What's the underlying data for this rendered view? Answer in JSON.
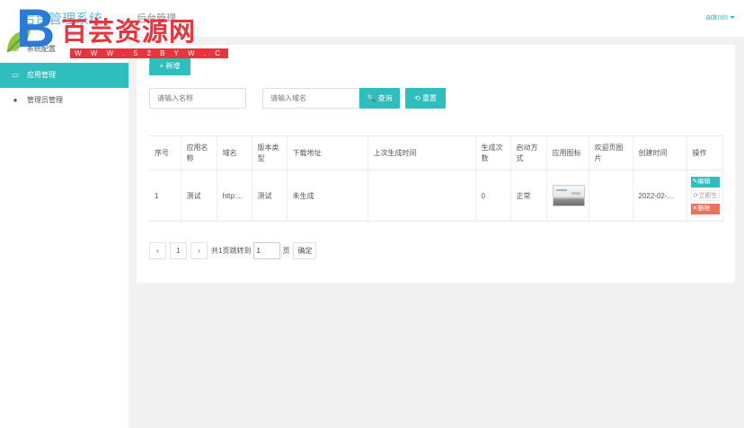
{
  "header": {
    "title": "后台管理系统",
    "subtitle": "后台管理",
    "user": "admin",
    "watermark_title": "百芸资源网",
    "watermark_url": "W W W . 5 2 B Y W . C N"
  },
  "sidebar": {
    "items": [
      {
        "label": "系统配置",
        "icon": "clipboard-icon",
        "active": false
      },
      {
        "label": "应用管理",
        "icon": "clipboard-icon",
        "active": true
      },
      {
        "label": "管理员管理",
        "icon": "user-icon",
        "active": false
      }
    ]
  },
  "toolbar": {
    "add_label": "+ 新增",
    "name_placeholder": "请输入名称",
    "domain_placeholder": "请输入域名",
    "search_label": "🔍 查询",
    "reset_label": "⟲ 重置"
  },
  "table": {
    "columns": [
      "序号",
      "应用名称",
      "域名",
      "版本类型",
      "下载地址",
      "上次生成时间",
      "生成次数",
      "启动方式",
      "应用图标",
      "欢迎页图片",
      "创建时间",
      "操作"
    ],
    "rows": [
      {
        "index": "1",
        "name": "测试",
        "domain": "http:...",
        "version_type": "测试",
        "download": "未生成",
        "last_generated": "",
        "generate_count": "0",
        "launch_mode": "正常",
        "welcome_image": "",
        "created": "2022-02-...",
        "ops": {
          "edit": "✎编辑",
          "generate": "⟳立即生",
          "delete": "✕删除"
        }
      }
    ]
  },
  "pager": {
    "prev": "‹",
    "page": "1",
    "next": "›",
    "summary": "共1页跳转到",
    "jump_value": "1",
    "page_unit": "页",
    "confirm": "确定"
  },
  "colors": {
    "accent": "#2fbdbd",
    "danger": "#f0705e",
    "watermark": "#e8343c"
  }
}
